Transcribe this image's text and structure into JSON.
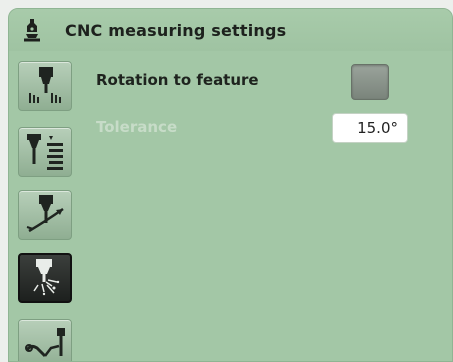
{
  "header": {
    "title": "CNC measuring settings",
    "icon": "measuring-probe-icon"
  },
  "sidebar": {
    "items": [
      {
        "icon": "probe-grid-icon",
        "active": false
      },
      {
        "icon": "probe-levels-icon",
        "active": false
      },
      {
        "icon": "probe-rotation-icon",
        "active": true
      },
      {
        "icon": "probe-sparkle-icon",
        "active": false
      },
      {
        "icon": "wrench-probe-icon",
        "active": false
      }
    ]
  },
  "settings": {
    "rotation_label": "Rotation to feature",
    "rotation_checked": false,
    "tolerance_label": "Tolerance",
    "tolerance_value": "15.0°"
  },
  "colors": {
    "panel": "#a3c7a6",
    "title_text": "#1d211d",
    "disabled_text": "#c7dcc8",
    "active_button": "#222522"
  }
}
